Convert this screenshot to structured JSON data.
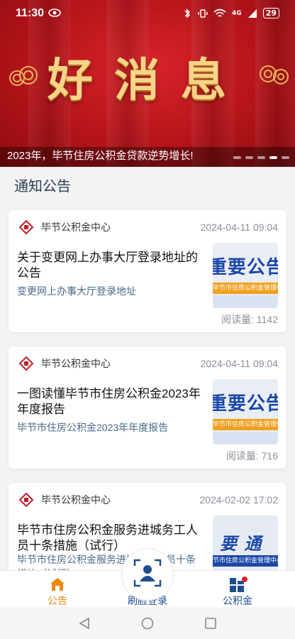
{
  "status_bar": {
    "time": "11:30",
    "network": "4G",
    "battery": "29"
  },
  "banner": {
    "headline": "好消息",
    "caption": "2023年，毕节住房公积金贷款逆势增长!",
    "dots_total": 5,
    "dots_active": 4
  },
  "section": {
    "title": "通知公告"
  },
  "notices": [
    {
      "org": "毕节公积金中心",
      "date": "2024-04-11 09:04",
      "title": "关于变更网上办事大厅登录地址的公告",
      "summary": "变更网上办事大厅登录地址",
      "reads_label": "阅读量:",
      "reads": "1142",
      "thumb_text": "重要公告",
      "thumb_strip": "毕节市住房公积金管理中心"
    },
    {
      "org": "毕节公积金中心",
      "date": "2024-04-11 09:04",
      "title": "一图读懂毕节市住房公积金2023年年度报告",
      "summary": "毕节市住房公积金2023年年度报告",
      "reads_label": "阅读量:",
      "reads": "716",
      "thumb_text": "重要公告",
      "thumb_strip": "毕节市住房公积金管理中心"
    },
    {
      "org": "毕节公积金中心",
      "date": "2024-02-02 17:02",
      "title": "毕节市住房公积金服务进城务工人员十条措施（试行）",
      "summary": "毕节市住房公积金服务进城务工人员十条措施（试行）",
      "thumb_text": "要 通",
      "thumb_strip": "节市住房公积金管理中心"
    }
  ],
  "bottom_nav": [
    {
      "label": "公告",
      "active": true
    },
    {
      "label": "刷脸登录",
      "active": false
    },
    {
      "label": "公积金",
      "active": false
    }
  ],
  "colors": {
    "accent": "#e98a14",
    "nav_blue": "#1f4e8c",
    "banner_red": "#c41a20",
    "gold": "#f8d486"
  }
}
